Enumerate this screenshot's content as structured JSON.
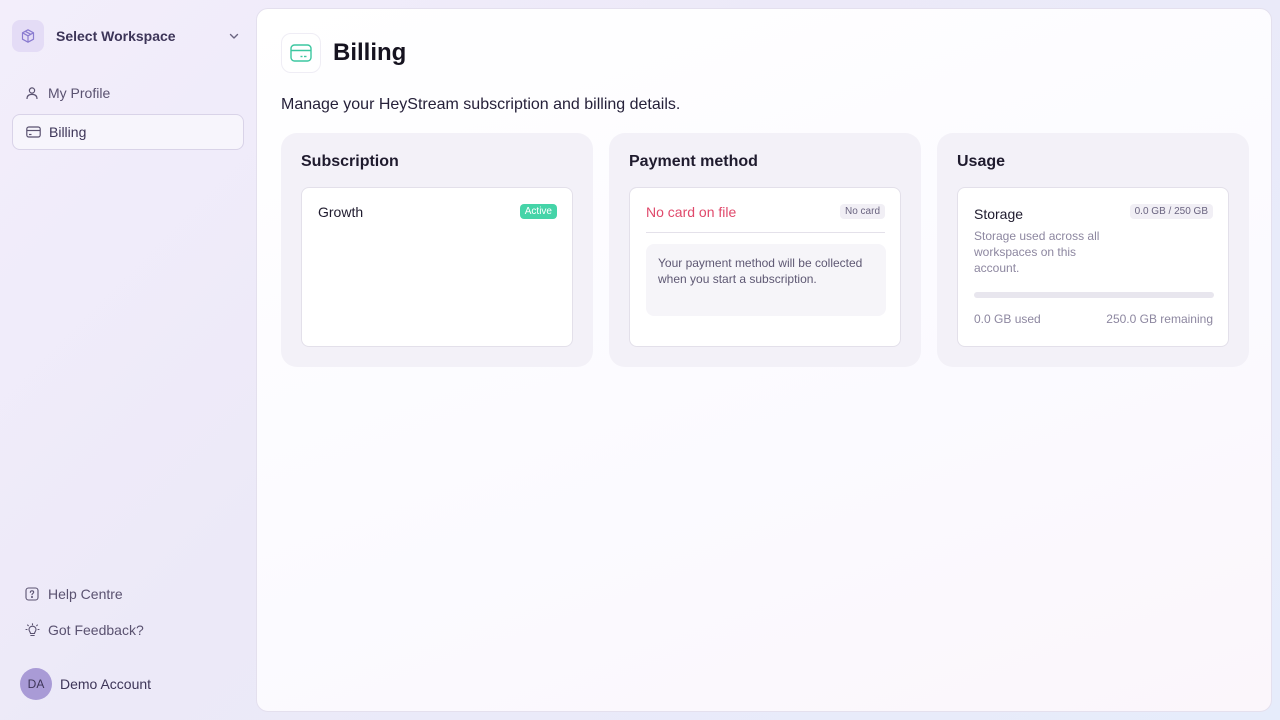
{
  "sidebar": {
    "workspace_label": "Select Workspace",
    "items": [
      {
        "label": "My Profile",
        "icon": "user-icon",
        "active": false
      },
      {
        "label": "Billing",
        "icon": "credit-card-icon",
        "active": true
      }
    ],
    "footer_items": [
      {
        "label": "Help Centre",
        "icon": "help-icon"
      },
      {
        "label": "Got Feedback?",
        "icon": "lightbulb-icon"
      }
    ],
    "account": {
      "initials": "DA",
      "name": "Demo Account"
    }
  },
  "page": {
    "title": "Billing",
    "icon": "credit-card-icon",
    "subtitle": "Manage your HeyStream subscription and billing details."
  },
  "subscription": {
    "title": "Subscription",
    "plan": "Growth",
    "status": "Active"
  },
  "payment": {
    "title": "Payment method",
    "status_text": "No card on file",
    "badge": "No card",
    "note": "Your payment method will be collected when you start a subscription."
  },
  "usage": {
    "title": "Usage",
    "storage_title": "Storage",
    "storage_desc": "Storage used across all workspaces on this account.",
    "quota": "0.0 GB / 250 GB",
    "used": "0.0 GB used",
    "remaining": "250.0 GB remaining",
    "used_fraction": 0
  },
  "colors": {
    "accent": "#45d4a8",
    "danger": "#e0496b",
    "icon_teal": "#3cc7a0"
  }
}
